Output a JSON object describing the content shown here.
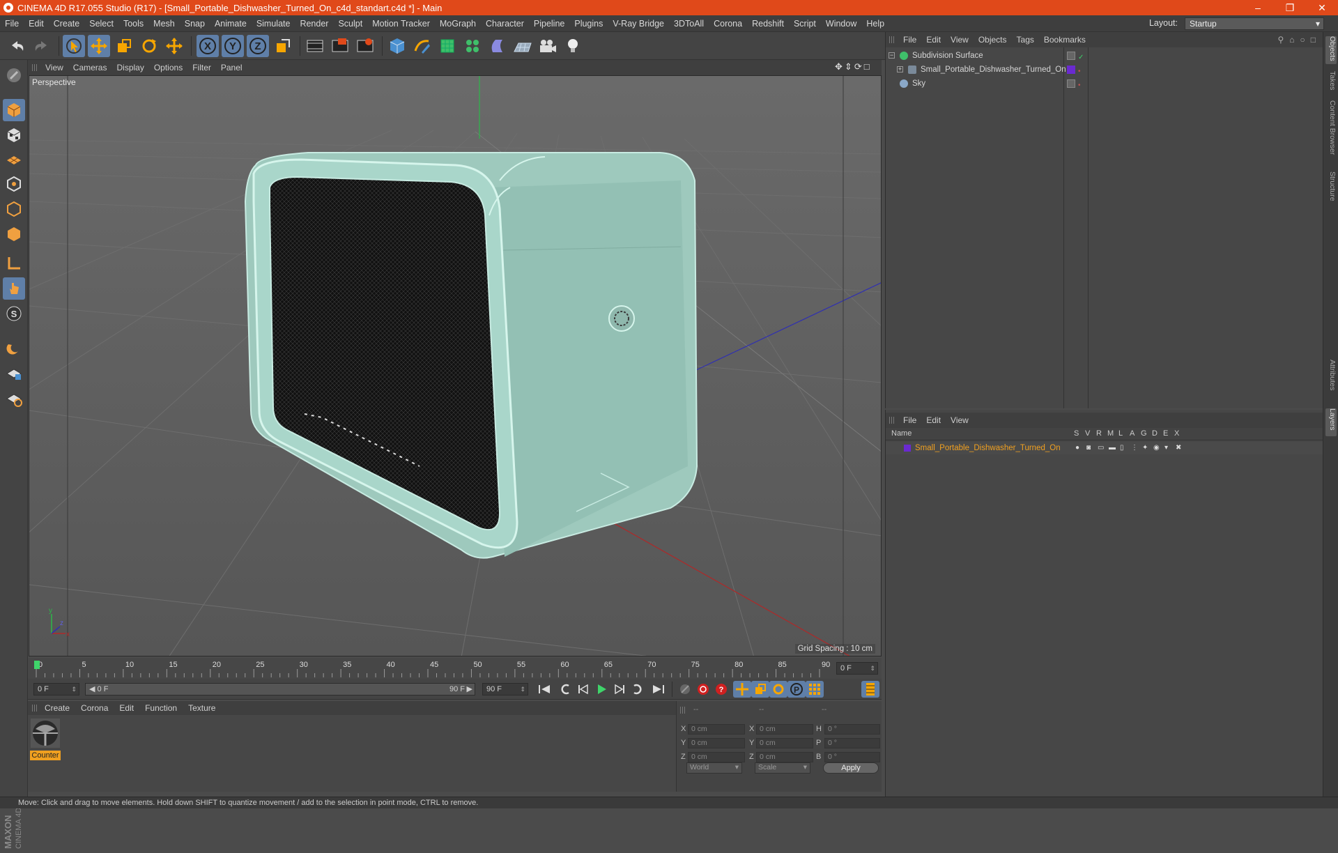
{
  "titlebar": {
    "title": "CINEMA 4D R17.055 Studio (R17) - [Small_Portable_Dishwasher_Turned_On_c4d_standart.c4d *] - Main"
  },
  "menubar": {
    "items": [
      "File",
      "Edit",
      "Create",
      "Select",
      "Tools",
      "Mesh",
      "Snap",
      "Animate",
      "Simulate",
      "Render",
      "Sculpt",
      "Motion Tracker",
      "MoGraph",
      "Character",
      "Pipeline",
      "Plugins",
      "V-Ray Bridge",
      "3DToAll",
      "Corona",
      "Redshift",
      "Script",
      "Window",
      "Help"
    ]
  },
  "layout": {
    "label": "Layout:",
    "value": "Startup"
  },
  "viewport": {
    "menu": [
      "View",
      "Cameras",
      "Display",
      "Options",
      "Filter",
      "Panel"
    ],
    "label": "Perspective",
    "grid_spacing": "Grid Spacing : 10 cm"
  },
  "timeline": {
    "ticks": [
      "0",
      "5",
      "10",
      "15",
      "20",
      "25",
      "30",
      "35",
      "40",
      "45",
      "50",
      "55",
      "60",
      "65",
      "70",
      "75",
      "80",
      "85",
      "90"
    ],
    "current_frame": "0 F",
    "start_field": "0 F",
    "range_start": "0 F",
    "range_end": "90 F",
    "end_field": "90 F"
  },
  "material_panel": {
    "menu": [
      "Create",
      "Corona",
      "Edit",
      "Function",
      "Texture"
    ],
    "material_name": "Counter"
  },
  "coords": {
    "header": [
      "--",
      "--",
      "--"
    ],
    "rows": [
      {
        "a": "X",
        "av": "0 cm",
        "b": "X",
        "bv": "0 cm",
        "c": "H",
        "cv": "0 °"
      },
      {
        "a": "Y",
        "av": "0 cm",
        "b": "Y",
        "bv": "0 cm",
        "c": "P",
        "cv": "0 °"
      },
      {
        "a": "Z",
        "av": "0 cm",
        "b": "Z",
        "bv": "0 cm",
        "c": "B",
        "cv": "0 °"
      }
    ],
    "mode": "World",
    "transform": "Scale",
    "apply": "Apply"
  },
  "object_manager": {
    "menu": [
      "File",
      "Edit",
      "View",
      "Objects",
      "Tags",
      "Bookmarks"
    ],
    "objects": [
      {
        "name": "Subdivision Surface",
        "color": "#3fbf6a"
      },
      {
        "name": "Small_Portable_Dishwasher_Turned_On",
        "color": "#7a8a9a"
      },
      {
        "name": "Sky",
        "color": "#8aa8c8"
      }
    ]
  },
  "layer_manager": {
    "menu": [
      "File",
      "Edit",
      "View"
    ],
    "columns": [
      "Name",
      "S",
      "V",
      "R",
      "M",
      "L",
      "A",
      "G",
      "D",
      "E",
      "X"
    ],
    "layers": [
      {
        "name": "Small_Portable_Dishwasher_Turned_On",
        "color": "#6a2ad0"
      }
    ]
  },
  "right_tabs": [
    "Objects",
    "Takes",
    "Content Browser",
    "Structure",
    "Attributes",
    "Layers"
  ],
  "statusbar": {
    "text": "Move: Click and drag to move elements. Hold down SHIFT to quantize movement / add to the selection in point mode, CTRL to remove."
  },
  "colors": {
    "accent": "#e0491a",
    "selection": "#5f7fa8",
    "layer_name": "#f0a020"
  }
}
